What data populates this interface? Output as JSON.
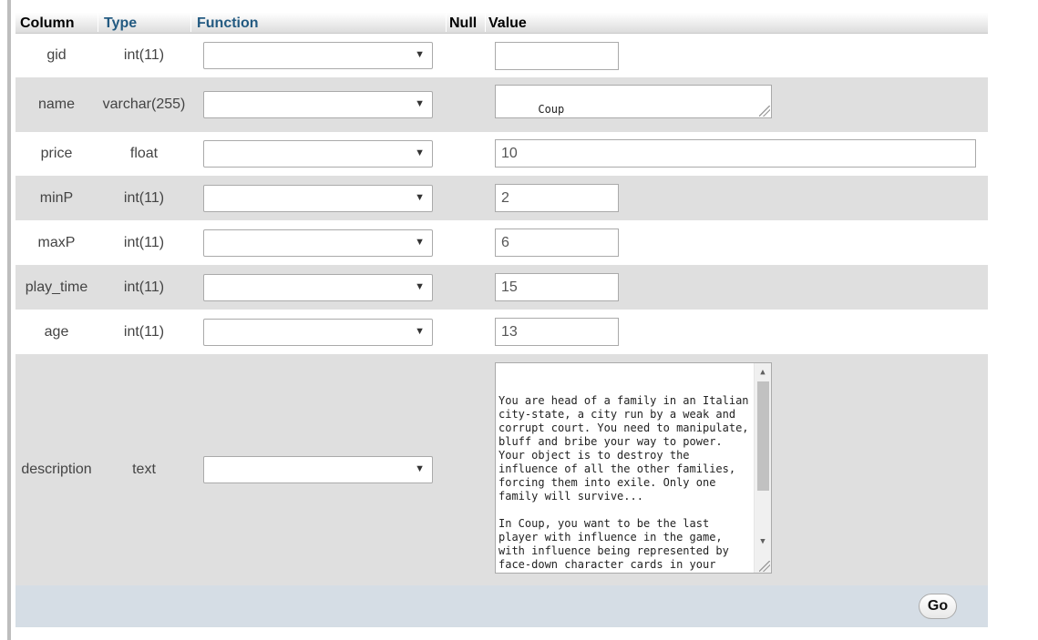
{
  "headers": {
    "column": "Column",
    "type": "Type",
    "function": "Function",
    "null": "Null",
    "value": "Value"
  },
  "rows": [
    {
      "name": "gid",
      "type": "int(11)",
      "value": ""
    },
    {
      "name": "name",
      "type": "varchar(255)",
      "value": "Coup"
    },
    {
      "name": "price",
      "type": "float",
      "value": "10"
    },
    {
      "name": "minP",
      "type": "int(11)",
      "value": "2"
    },
    {
      "name": "maxP",
      "type": "int(11)",
      "value": "6"
    },
    {
      "name": "play_time",
      "type": "int(11)",
      "value": "15"
    },
    {
      "name": "age",
      "type": "int(11)",
      "value": "13"
    },
    {
      "name": "description",
      "type": "text",
      "value": "You are head of a family in an Italian city-state, a city run by a weak and corrupt court. You need to manipulate, bluff and bribe your way to power. Your object is to destroy the influence of all the other families, forcing them into exile. Only one family will survive...\n\nIn Coup, you want to be the last player with influence in the game, with influence being represented by face-down character cards in your playing area."
    }
  ],
  "function_select_value": "",
  "go_label": "Go",
  "icons": {
    "select_arrow": "dropdown-arrow-icon",
    "resize": "resize-grip-icon"
  }
}
